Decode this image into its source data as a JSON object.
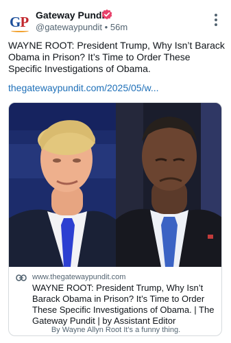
{
  "header": {
    "avatar_text": "GP",
    "display_name": "Gateway Pundit",
    "handle": "@gatewaypundit",
    "separator": "•",
    "time_ago": "56m",
    "badge_color": "#e8426b"
  },
  "post": {
    "text": "WAYNE ROOT: President Trump, Why Isn’t Barack Obama in Prison? It’s Time to Order These Specific Investigations of Obama.",
    "link_text": "thegatewaypundit.com/2025/05/w..."
  },
  "card": {
    "image_alt": "Side-by-side photos of Donald Trump and Barack Obama",
    "domain": "www.thegatewaypundit.com",
    "title": "WAYNE ROOT: President Trump, Why Isn’t Barack Obama in Prison? It’s Time to Order These Specific Investigations of Obama. | The Gateway Pundit | by Assistant Editor",
    "description": "By Wayne Allyn Root It’s a funny thing."
  },
  "icons": {
    "menu": "more-vertical-icon",
    "verified": "verified-badge-icon",
    "link": "link-icon"
  },
  "colors": {
    "link": "#1d6fb8",
    "muted": "#536471",
    "card_border": "#d6dadd"
  }
}
